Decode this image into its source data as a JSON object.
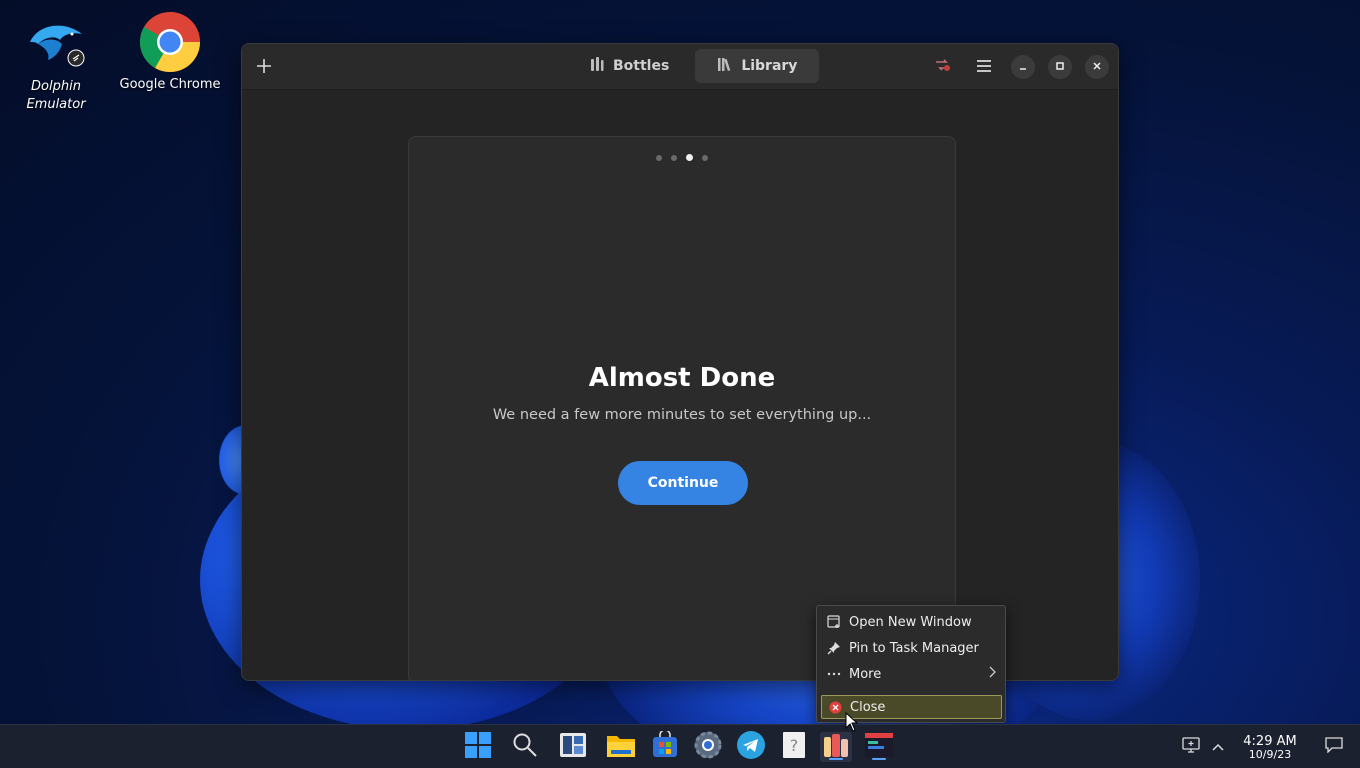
{
  "desktop": {
    "icons": [
      {
        "label": "Dolphin Emulator",
        "icon": "dolphin-icon"
      },
      {
        "label": "Google Chrome",
        "icon": "chrome-icon"
      }
    ]
  },
  "window": {
    "tabs": [
      {
        "label": "Bottles",
        "icon": "bottles-icon",
        "active": false
      },
      {
        "label": "Library",
        "icon": "library-icon",
        "active": true
      }
    ],
    "new_icon": "plus-icon",
    "controls": [
      "minimize",
      "maximize",
      "close"
    ]
  },
  "onboarding": {
    "page_count": 4,
    "current_page": 3,
    "title": "Almost Done",
    "subtitle": "We need a few more minutes to set everything up...",
    "continue_label": "Continue"
  },
  "context_menu": {
    "items": [
      {
        "label": "Open New Window",
        "icon": "new-window-icon"
      },
      {
        "label": "Pin to Task Manager",
        "icon": "pin-icon"
      },
      {
        "label": "More",
        "icon": "more-icon",
        "submenu": true
      },
      {
        "label": "Close",
        "icon": "close-circle-icon",
        "highlighted": true
      }
    ]
  },
  "taskbar": {
    "clock_time": "4:29 AM",
    "clock_date": "10/9/23",
    "apps": [
      "start-icon",
      "search-icon",
      "task-view-icon",
      "file-manager-icon",
      "store-icon",
      "settings-icon",
      "telegram-icon",
      "help-icon",
      "bottles-app-icon",
      "terminal-app-icon"
    ]
  },
  "colors": {
    "accent": "#3584e4",
    "window_bg": "#242424",
    "dialog_bg": "#2b2b2b"
  }
}
